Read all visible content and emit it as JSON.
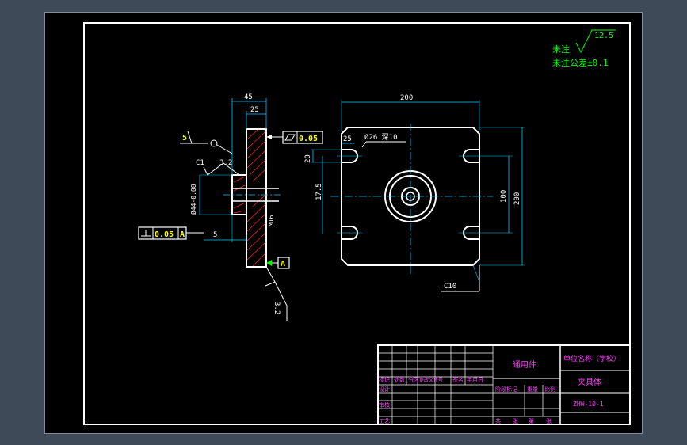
{
  "notes": {
    "line1_prefix": "未注",
    "roughness_value": "12.5",
    "line2": "未注公差±0.1"
  },
  "side_view": {
    "dim_45": "45",
    "dim_25": "25",
    "dim_32": "3.2",
    "dim_c1": "C1",
    "dim_phi": "Ø44-0.08",
    "dim_m16": "M16",
    "dim_5": "5",
    "flatness_label": "0.05",
    "perp_label": "0.05",
    "perp_datum": "A",
    "datum_a": "A",
    "label_5": "5",
    "roughness_bottom": "3.2"
  },
  "front_view": {
    "dim_200_top": "200",
    "dim_200_right": "200",
    "dim_100": "100",
    "dim_25": "25",
    "dim_20": "20",
    "dim_175": "17.5",
    "hole_label": "Ø26 深10",
    "dim_c10": "C10"
  },
  "title_block": {
    "part_name": "通用件",
    "company": "单位名称（学校）",
    "drawing_name": "夹具体",
    "drawing_no": "ZHW-10-1",
    "row_labels": [
      "标记",
      "设计",
      "审核",
      "工艺"
    ],
    "header_labels": [
      "处数",
      "分区",
      "更改文件号",
      "签名",
      "年月日"
    ],
    "stage_labels": [
      "阶段标记",
      "重量",
      "比例"
    ],
    "sheet_labels": [
      "共",
      "张",
      "第",
      "张"
    ]
  }
}
